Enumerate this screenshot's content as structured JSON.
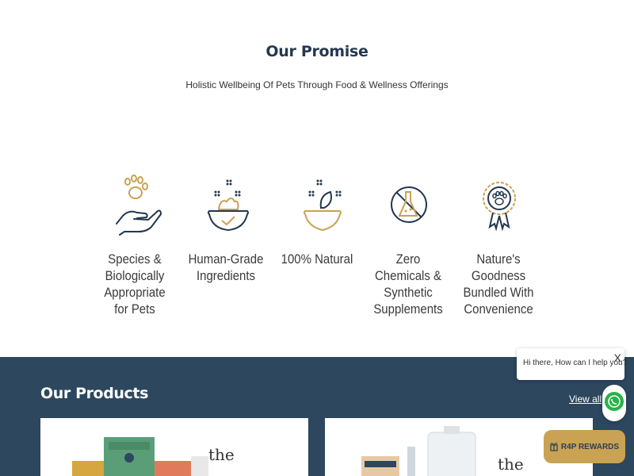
{
  "promise": {
    "title": "Our Promise",
    "subtitle": "Holistic Wellbeing Of Pets Through Food & Wellness Offerings",
    "features": [
      {
        "label": "Species & Biologically Appropriate for Pets",
        "icon": "paw-hand-icon"
      },
      {
        "label": "Human-Grade Ingredients",
        "icon": "food-bowl-icon"
      },
      {
        "label": "100% Natural",
        "icon": "leaf-bowl-icon"
      },
      {
        "label": "Zero Chemicals & Synthetic Supplements",
        "icon": "no-chemicals-icon"
      },
      {
        "label": "Nature's Goodness Bundled With Convenience",
        "icon": "paw-badge-icon"
      }
    ]
  },
  "products": {
    "title": "Our Products",
    "view_all": "View all",
    "card1_text": "the",
    "card2_text": "the"
  },
  "chat": {
    "greeting": "Hi there, How can I help you?",
    "close": "X"
  },
  "rewards": {
    "label": "R4P REWARDS"
  },
  "colors": {
    "navy": "#2c475e",
    "gold": "#c9a253",
    "whatsapp": "#25b346"
  }
}
